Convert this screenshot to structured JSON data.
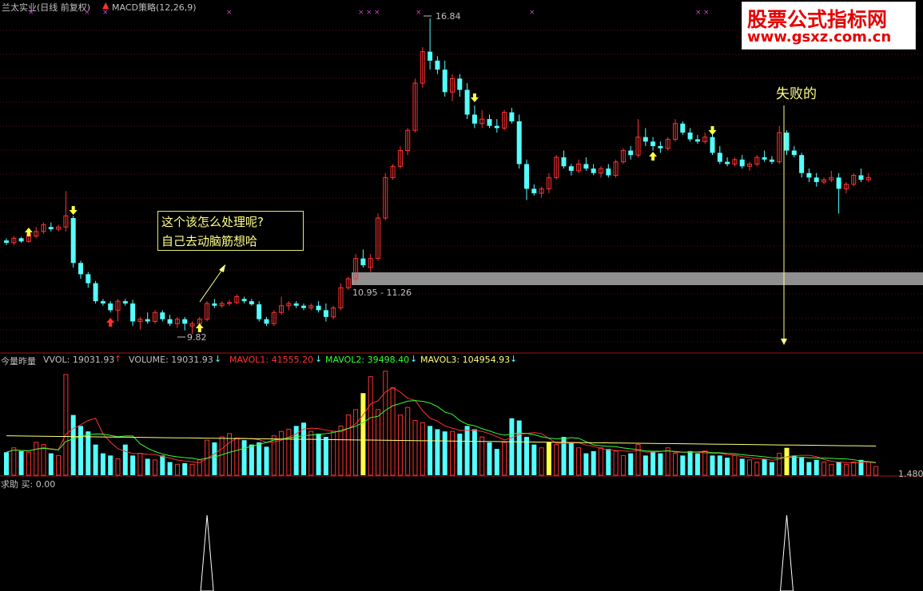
{
  "header": {
    "title": "兰太实业(日线 前复权)",
    "indicator": "MACD策略(12,26,9)"
  },
  "watermark": {
    "line1": "股票公式指标网",
    "line2": "www.gsxz.com.cn"
  },
  "annotations": {
    "question_line1": "这个该怎么处理呢?",
    "question_line2": "自己去动脑筋想哈",
    "fail_label": "失败的",
    "high_price": "16.84",
    "low_price": "9.82",
    "zone_label": "10.95 - 11.26"
  },
  "volume_panel": {
    "name": "今量昨量",
    "vvol": "VVOL: 19031.93",
    "volume": "VOLUME: 19031.93",
    "mavol1": "MAVOL1: 41555.20",
    "mavol2": "MAVOL2: 39498.40",
    "mavol3": "MAVOL3: 104954.93",
    "last_value": "1.480"
  },
  "signal_panel": {
    "label": "求助 买: 0.00"
  },
  "colors": {
    "up": "#ff3232",
    "down": "#54ffff",
    "ma1": "#ff3232",
    "ma2": "#32ff32",
    "ma3": "#ffff78",
    "highlight": "#ffff44",
    "panel_border": "#a01818",
    "grid": "#601010"
  },
  "chart_data": {
    "type": "candlestick",
    "note_markers": [
      "buy-arrow",
      "sell-arrow",
      "red-arrow"
    ],
    "candles": [
      [
        11.9,
        11.95,
        11.8,
        11.85
      ],
      [
        11.85,
        12.0,
        11.8,
        11.95
      ],
      [
        11.95,
        11.98,
        11.85,
        11.88
      ],
      [
        11.88,
        12.1,
        11.85,
        12.05
      ],
      [
        12.0,
        12.2,
        11.95,
        12.1
      ],
      [
        12.1,
        12.3,
        12.05,
        12.25
      ],
      [
        12.2,
        12.3,
        12.1,
        12.15
      ],
      [
        12.15,
        12.25,
        12.1,
        12.2
      ],
      [
        12.2,
        13.0,
        12.1,
        12.45
      ],
      [
        12.4,
        12.45,
        11.3,
        11.4
      ],
      [
        11.4,
        11.45,
        11.05,
        11.15
      ],
      [
        11.15,
        11.2,
        10.85,
        10.95
      ],
      [
        10.95,
        11.0,
        10.5,
        10.55
      ],
      [
        10.55,
        10.6,
        10.45,
        10.5
      ],
      [
        10.5,
        10.55,
        10.3,
        10.35
      ],
      [
        10.35,
        10.6,
        10.1,
        10.55
      ],
      [
        10.55,
        10.6,
        10.45,
        10.5
      ],
      [
        10.5,
        10.58,
        10.0,
        10.1
      ],
      [
        10.1,
        10.2,
        9.92,
        10.15
      ],
      [
        10.15,
        10.3,
        10.05,
        10.1
      ],
      [
        10.1,
        10.35,
        10.05,
        10.3
      ],
      [
        10.3,
        10.35,
        10.1,
        10.15
      ],
      [
        10.15,
        10.25,
        10.0,
        10.05
      ],
      [
        10.05,
        10.2,
        9.95,
        10.15
      ],
      [
        10.15,
        10.2,
        9.9,
        10.05
      ],
      [
        10.0,
        10.1,
        9.82,
        10.05
      ],
      [
        10.05,
        10.2,
        10.0,
        10.15
      ],
      [
        10.15,
        10.55,
        10.1,
        10.5
      ],
      [
        10.5,
        10.6,
        10.4,
        10.45
      ],
      [
        10.45,
        10.55,
        10.4,
        10.5
      ],
      [
        10.5,
        10.58,
        10.45,
        10.52
      ],
      [
        10.52,
        10.7,
        10.48,
        10.65
      ],
      [
        10.6,
        10.65,
        10.5,
        10.55
      ],
      [
        10.55,
        10.6,
        10.45,
        10.48
      ],
      [
        10.48,
        10.55,
        10.1,
        10.15
      ],
      [
        10.15,
        10.2,
        10.0,
        10.05
      ],
      [
        10.05,
        10.35,
        10.0,
        10.3
      ],
      [
        10.3,
        10.65,
        10.25,
        10.45
      ],
      [
        10.45,
        10.55,
        10.35,
        10.5
      ],
      [
        10.5,
        10.55,
        10.4,
        10.45
      ],
      [
        10.45,
        10.5,
        10.35,
        10.4
      ],
      [
        10.4,
        10.5,
        10.35,
        10.45
      ],
      [
        10.45,
        10.55,
        10.3,
        10.35
      ],
      [
        10.35,
        10.5,
        10.1,
        10.2
      ],
      [
        10.2,
        10.45,
        10.15,
        10.4
      ],
      [
        10.4,
        10.95,
        10.35,
        10.85
      ],
      [
        10.85,
        11.1,
        10.8,
        11.05
      ],
      [
        11.05,
        11.6,
        11.0,
        11.5
      ],
      [
        11.5,
        11.7,
        11.3,
        11.35
      ],
      [
        11.3,
        11.6,
        11.2,
        11.5
      ],
      [
        11.5,
        12.5,
        11.45,
        12.4
      ],
      [
        12.4,
        13.4,
        12.35,
        13.3
      ],
      [
        13.3,
        13.6,
        13.25,
        13.55
      ],
      [
        13.55,
        14.0,
        13.5,
        13.9
      ],
      [
        13.9,
        14.4,
        13.8,
        14.35
      ],
      [
        14.35,
        15.5,
        14.3,
        15.4
      ],
      [
        15.4,
        16.2,
        15.3,
        16.1
      ],
      [
        16.1,
        16.84,
        15.7,
        15.9
      ],
      [
        15.9,
        16.0,
        15.6,
        15.7
      ],
      [
        15.7,
        15.9,
        15.1,
        15.2
      ],
      [
        15.2,
        15.6,
        15.0,
        15.5
      ],
      [
        15.5,
        15.6,
        15.1,
        15.25
      ],
      [
        15.25,
        15.4,
        14.6,
        14.7
      ],
      [
        14.7,
        14.9,
        14.4,
        14.5
      ],
      [
        14.5,
        14.8,
        14.4,
        14.6
      ],
      [
        14.6,
        14.7,
        14.4,
        14.45
      ],
      [
        14.45,
        14.6,
        14.3,
        14.4
      ],
      [
        14.4,
        14.8,
        14.35,
        14.75
      ],
      [
        14.75,
        14.85,
        14.5,
        14.55
      ],
      [
        14.55,
        14.7,
        13.5,
        13.6
      ],
      [
        13.6,
        13.7,
        12.8,
        13.05
      ],
      [
        13.05,
        13.15,
        12.9,
        12.95
      ],
      [
        12.95,
        13.1,
        12.85,
        13.05
      ],
      [
        13.05,
        13.4,
        12.95,
        13.3
      ],
      [
        13.3,
        13.8,
        13.25,
        13.75
      ],
      [
        13.75,
        13.9,
        13.5,
        13.55
      ],
      [
        13.55,
        13.6,
        13.35,
        13.45
      ],
      [
        13.45,
        13.7,
        13.4,
        13.6
      ],
      [
        13.6,
        13.75,
        13.45,
        13.5
      ],
      [
        13.5,
        13.6,
        13.35,
        13.4
      ],
      [
        13.4,
        13.55,
        13.3,
        13.5
      ],
      [
        13.5,
        13.6,
        13.3,
        13.35
      ],
      [
        13.35,
        13.7,
        13.3,
        13.65
      ],
      [
        13.65,
        13.95,
        13.6,
        13.9
      ],
      [
        13.9,
        14.0,
        13.7,
        13.8
      ],
      [
        13.8,
        14.6,
        13.75,
        14.2
      ],
      [
        14.2,
        14.4,
        14.0,
        14.1
      ],
      [
        14.1,
        14.2,
        13.9,
        14.0
      ],
      [
        14.0,
        14.1,
        13.85,
        13.95
      ],
      [
        13.95,
        14.2,
        13.9,
        14.15
      ],
      [
        14.15,
        14.6,
        14.1,
        14.5
      ],
      [
        14.5,
        14.55,
        14.25,
        14.3
      ],
      [
        14.3,
        14.4,
        14.1,
        14.15
      ],
      [
        14.15,
        14.25,
        14.05,
        14.1
      ],
      [
        14.1,
        14.3,
        14.05,
        14.2
      ],
      [
        14.2,
        14.3,
        13.8,
        13.85
      ],
      [
        13.85,
        14.0,
        13.6,
        13.65
      ],
      [
        13.65,
        13.75,
        13.55,
        13.6
      ],
      [
        13.6,
        13.75,
        13.55,
        13.7
      ],
      [
        13.7,
        13.8,
        13.5,
        13.55
      ],
      [
        13.55,
        13.65,
        13.45,
        13.6
      ],
      [
        13.6,
        13.8,
        13.55,
        13.75
      ],
      [
        13.75,
        13.9,
        13.65,
        13.7
      ],
      [
        13.7,
        13.78,
        13.6,
        13.65
      ],
      [
        13.65,
        14.45,
        13.6,
        14.3
      ],
      [
        14.3,
        14.35,
        13.8,
        13.9
      ],
      [
        13.9,
        14.0,
        13.75,
        13.8
      ],
      [
        13.8,
        13.85,
        13.3,
        13.4
      ],
      [
        13.4,
        13.5,
        13.2,
        13.3
      ],
      [
        13.3,
        13.4,
        13.1,
        13.2
      ],
      [
        13.2,
        13.3,
        13.15,
        13.25
      ],
      [
        13.25,
        13.45,
        13.2,
        13.3
      ],
      [
        13.3,
        13.4,
        12.5,
        13.05
      ],
      [
        13.05,
        13.2,
        12.95,
        13.15
      ],
      [
        13.15,
        13.4,
        13.1,
        13.35
      ],
      [
        13.35,
        13.5,
        13.2,
        13.25
      ],
      [
        13.25,
        13.4,
        13.2,
        13.3
      ]
    ],
    "volumes": [
      21,
      25,
      22,
      21,
      30,
      28,
      20,
      18,
      92,
      55,
      45,
      40,
      28,
      20,
      18,
      15,
      28,
      18,
      20,
      15,
      14,
      18,
      12,
      10,
      11,
      10,
      14,
      32,
      30,
      35,
      38,
      34,
      32,
      28,
      30,
      26,
      36,
      40,
      42,
      45,
      48,
      40,
      38,
      35,
      40,
      45,
      55,
      60,
      75,
      90,
      60,
      95,
      80,
      55,
      62,
      50,
      48,
      45,
      42,
      40,
      40,
      38,
      45,
      42,
      35,
      30,
      24,
      30,
      52,
      50,
      35,
      28,
      25,
      30,
      28,
      35,
      30,
      25,
      20,
      22,
      25,
      24,
      22,
      18,
      20,
      28,
      18,
      22,
      20,
      25,
      20,
      18,
      22,
      20,
      22,
      18,
      18,
      16,
      18,
      15,
      14,
      12,
      15,
      12,
      20,
      25,
      18,
      16,
      12,
      14,
      12,
      10,
      12,
      10,
      12,
      14,
      12,
      8
    ],
    "vol_highlight_index": [
      48,
      73,
      105
    ],
    "signal_spikes_index": [
      27,
      105
    ]
  }
}
